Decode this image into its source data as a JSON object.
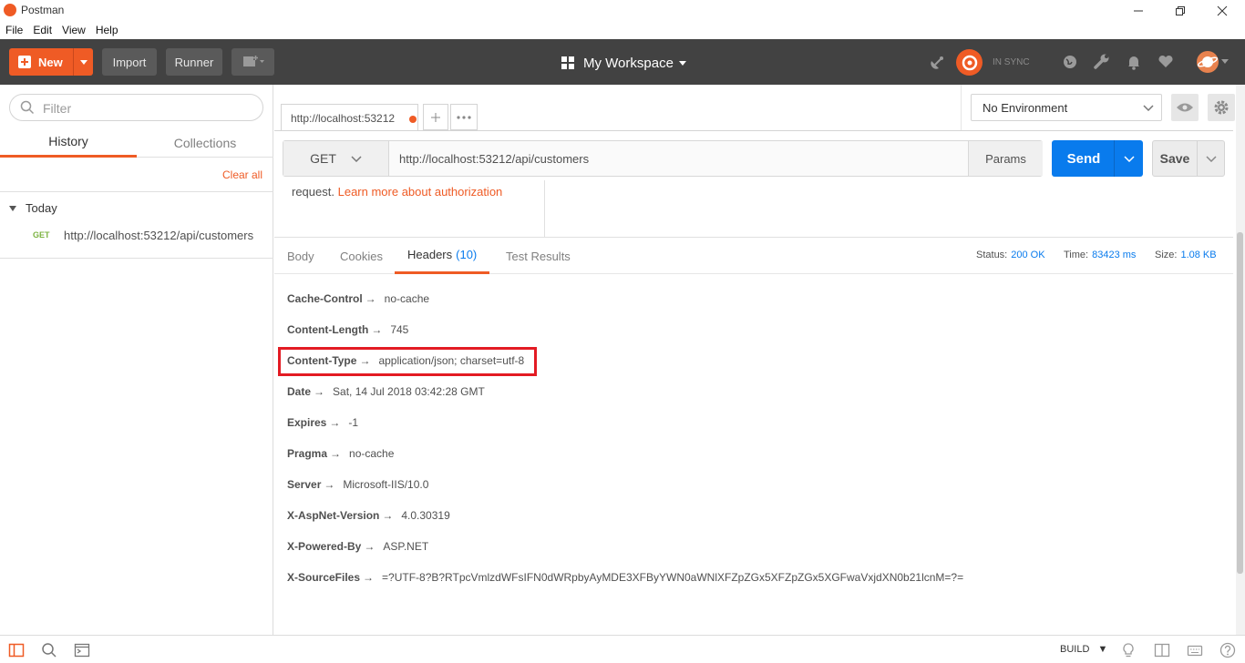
{
  "window": {
    "title": "Postman"
  },
  "menu": [
    "File",
    "Edit",
    "View",
    "Help"
  ],
  "header": {
    "new_label": "New",
    "import_label": "Import",
    "runner_label": "Runner",
    "workspace_label": "My Workspace",
    "sync_status": "IN SYNC",
    "accent_color": "#ef5b25"
  },
  "sidebar": {
    "filter_placeholder": "Filter",
    "tabs": [
      "History",
      "Collections"
    ],
    "active_tab": "History",
    "clear_all_label": "Clear all",
    "group_label": "Today",
    "history": [
      {
        "method": "GET",
        "url": "http://localhost:53212/api/customers"
      }
    ]
  },
  "request_tab": {
    "label": "http://localhost:53212"
  },
  "environment": {
    "selected": "No Environment"
  },
  "request": {
    "method": "GET",
    "url": "http://localhost:53212/api/customers",
    "params_label": "Params",
    "send_label": "Send",
    "save_label": "Save"
  },
  "auth": {
    "text_prefix": "request.",
    "link_label": "Learn more about authorization"
  },
  "response": {
    "tabs": [
      "Body",
      "Cookies",
      "Headers",
      "Test Results"
    ],
    "headers_count": "(10)",
    "active_tab": "Headers",
    "status_label": "Status:",
    "status_value": "200 OK",
    "time_label": "Time:",
    "time_value": "83423 ms",
    "size_label": "Size:",
    "size_value": "1.08 KB",
    "headers": [
      {
        "key": "Cache-Control",
        "value": "no-cache"
      },
      {
        "key": "Content-Length",
        "value": "745"
      },
      {
        "key": "Content-Type",
        "value": "application/json; charset=utf-8",
        "highlighted": true
      },
      {
        "key": "Date",
        "value": "Sat, 14 Jul 2018 03:42:28 GMT"
      },
      {
        "key": "Expires",
        "value": "-1"
      },
      {
        "key": "Pragma",
        "value": "no-cache"
      },
      {
        "key": "Server",
        "value": "Microsoft-IIS/10.0"
      },
      {
        "key": "X-AspNet-Version",
        "value": "4.0.30319"
      },
      {
        "key": "X-Powered-By",
        "value": "ASP.NET"
      },
      {
        "key": "X-SourceFiles",
        "value": "=?UTF-8?B?RTpcVmlzdWFsIFN0dWRpbyAyMDE3XFByYWN0aWNlXFZpZGx5XFZpZGx5XGFwaVxjdXN0b21lcnM=?="
      }
    ],
    "arrow_glyph": "→",
    "link_color": "#097bed",
    "highlight_color": "#e31b23"
  },
  "statusbar": {
    "build_label": "BUILD"
  }
}
